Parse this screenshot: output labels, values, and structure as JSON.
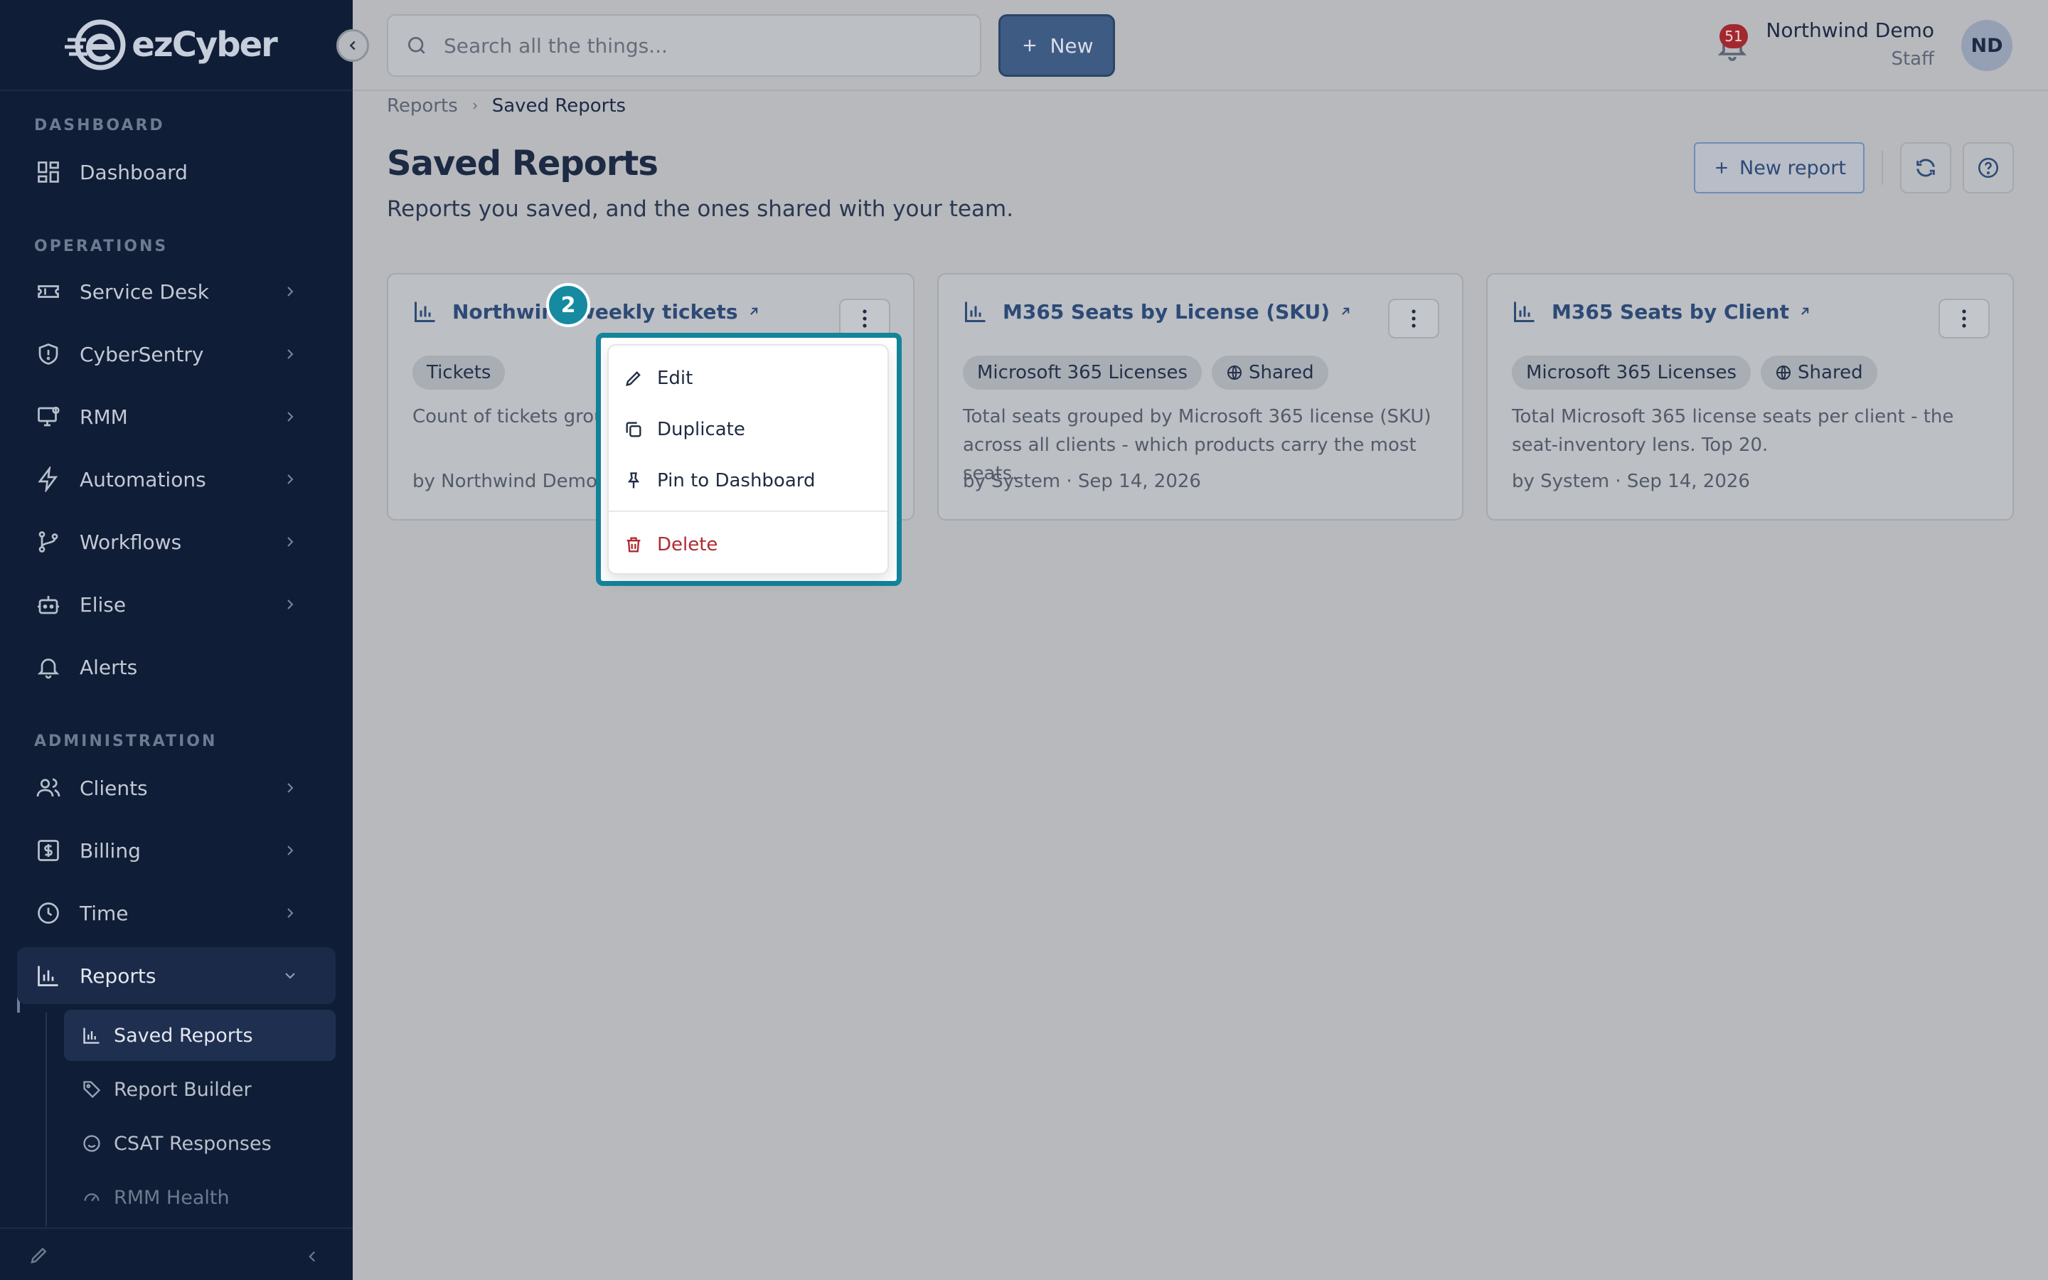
{
  "brand": {
    "logo_text": "ezCyber"
  },
  "sidebar": {
    "sections": [
      {
        "label": "DASHBOARD"
      },
      {
        "label": "OPERATIONS"
      },
      {
        "label": "ADMINISTRATION"
      }
    ],
    "items": [
      {
        "label": "Dashboard",
        "icon": "grid-icon"
      },
      {
        "label": "Service Desk",
        "icon": "ticket-icon"
      },
      {
        "label": "CyberSentry",
        "icon": "shield-icon"
      },
      {
        "label": "RMM",
        "icon": "monitor-gear-icon"
      },
      {
        "label": "Automations",
        "icon": "lightning-icon"
      },
      {
        "label": "Workflows",
        "icon": "branch-icon"
      },
      {
        "label": "Elise",
        "icon": "robot-icon"
      },
      {
        "label": "Alerts",
        "icon": "bell-icon"
      },
      {
        "label": "Clients",
        "icon": "users-icon"
      },
      {
        "label": "Billing",
        "icon": "dollar-icon"
      },
      {
        "label": "Time",
        "icon": "clock-icon"
      },
      {
        "label": "Reports",
        "icon": "bar-chart-icon"
      }
    ],
    "sub_items": [
      {
        "label": "Saved Reports",
        "icon": "bar-chart-icon"
      },
      {
        "label": "Report Builder",
        "icon": "tag-icon"
      },
      {
        "label": "CSAT Responses",
        "icon": "smile-icon"
      },
      {
        "label": "RMM Health",
        "icon": "gauge-icon"
      }
    ]
  },
  "topbar": {
    "search_placeholder": "Search all the things...",
    "new_label": "New",
    "notifications_count": "51",
    "user_name": "Northwind Demo",
    "user_role": "Staff",
    "avatar_initials": "ND"
  },
  "breadcrumb": {
    "parent": "Reports",
    "current": "Saved Reports"
  },
  "page": {
    "title": "Saved Reports",
    "subtitle": "Reports you saved, and the ones shared with your team.",
    "new_report_label": "New report"
  },
  "cards": [
    {
      "title": "Northwind weekly tickets",
      "tags": [
        "Tickets"
      ],
      "description": "Count of tickets grouped by",
      "meta": "by Northwind Demo · Sep 14, 2026"
    },
    {
      "title": "M365 Seats by License (SKU)",
      "tags": [
        "Microsoft 365 Licenses",
        "Shared"
      ],
      "description": "Total seats grouped by Microsoft 365 license (SKU) across all clients - which products carry the most seats.",
      "meta": "by System · Sep 14, 2026"
    },
    {
      "title": "M365 Seats by Client",
      "tags": [
        "Microsoft 365 Licenses",
        "Shared"
      ],
      "description": "Total Microsoft 365 license seats per client - the seat-inventory lens. Top 20.",
      "meta": "by System · Sep 14, 2026"
    }
  ],
  "context_menu": {
    "items": [
      {
        "label": "Edit",
        "icon": "pencil-icon"
      },
      {
        "label": "Duplicate",
        "icon": "copy-icon"
      },
      {
        "label": "Pin to Dashboard",
        "icon": "pin-icon"
      },
      {
        "label": "Delete",
        "icon": "trash-icon"
      }
    ]
  },
  "step_badge": "2",
  "colors": {
    "sidebar_bg": "#0f1d36",
    "accent": "#2d4a77",
    "highlight": "#13849b",
    "danger": "#b02a30"
  }
}
